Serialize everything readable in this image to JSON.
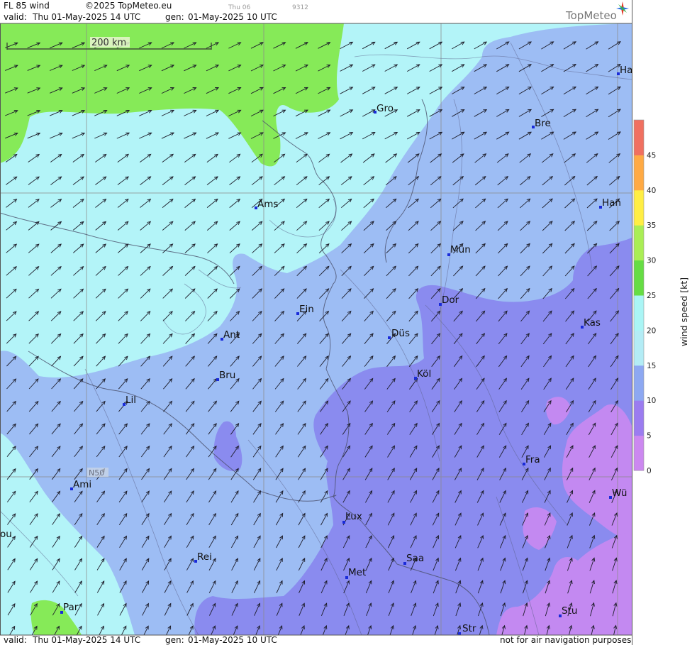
{
  "header": {
    "product": "FL 85 wind",
    "copyright": "©2025 TopMeteo.eu",
    "day_small": "Thu 06",
    "code_small": "9312",
    "valid_label": "valid:",
    "valid_value": "Thu  01-May-2025  14 UTC",
    "gen_label": "gen:",
    "gen_value": "01-May-2025 10 UTC",
    "brand": "TopMeteo"
  },
  "footer": {
    "valid_label": "valid:",
    "valid_value": "Thu  01-May-2025  14 UTC",
    "gen_label": "gen:",
    "gen_value": "01-May-2025 10 UTC",
    "disclaimer": "not for air navigation purposes"
  },
  "scale_bar": {
    "label": "200 km"
  },
  "graticule_label": "N50",
  "cities": [
    {
      "name": "Ha"
    },
    {
      "name": "Gro"
    },
    {
      "name": "Bre"
    },
    {
      "name": "Ams"
    },
    {
      "name": "Han"
    },
    {
      "name": "Mün"
    },
    {
      "name": "Ein"
    },
    {
      "name": "Dor"
    },
    {
      "name": "Kas"
    },
    {
      "name": "Ant"
    },
    {
      "name": "Düs"
    },
    {
      "name": "Bru"
    },
    {
      "name": "Köl"
    },
    {
      "name": "Lil"
    },
    {
      "name": "Fra"
    },
    {
      "name": "Ami"
    },
    {
      "name": "Wü"
    },
    {
      "name": "Lux"
    },
    {
      "name": "ou"
    },
    {
      "name": "Rei"
    },
    {
      "name": "Saa"
    },
    {
      "name": "Met"
    },
    {
      "name": "Par"
    },
    {
      "name": "Stu"
    },
    {
      "name": "Str"
    }
  ],
  "legend": {
    "title": "wind  speed  [kt]",
    "ticks": [
      "0",
      "5",
      "10",
      "15",
      "20",
      "25",
      "30",
      "35",
      "40",
      "45"
    ],
    "colors": [
      "#cc88f0",
      "#9b7cf0",
      "#8da8f2",
      "#b3ecf5",
      "#aaf5f5",
      "#66dd44",
      "#aaee55",
      "#ffee44",
      "#ffaa44",
      "#f07060"
    ]
  },
  "map_colors": {
    "calm_cyan": "#b3f4f8",
    "green": "#86ea58",
    "light_blue": "#9dbdf4",
    "blue_violet": "#8a8bef",
    "violet": "#c389f1",
    "city_marker": "#1a2bd9"
  },
  "wind_direction": "from southwest"
}
